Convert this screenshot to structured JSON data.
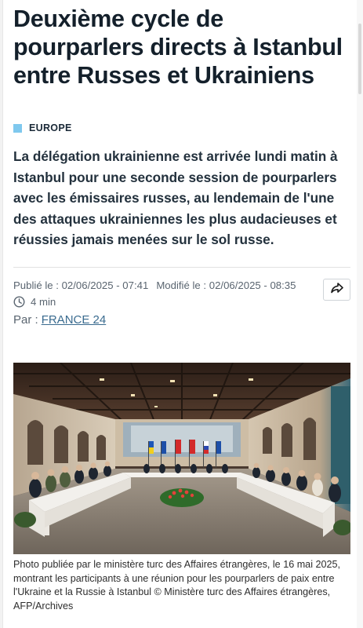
{
  "article": {
    "headline": "Deuxième cycle de pourparlers directs à Istanbul entre Russes et Ukrainiens",
    "section": "EUROPE",
    "lede": "La délégation ukrainienne est arrivée lundi matin à Istanbul pour une seconde session de pourparlers avec les émissaires russes, au lendemain de l'une des attaques ukrainiennes les plus audacieuses et réussies jamais menées sur le sol russe.",
    "published": "Publié le : 02/06/2025 - 07:41",
    "modified": "Modifié le : 02/06/2025 - 08:35",
    "read_time": "4 min",
    "byline_prefix": "Par :",
    "byline_source": "FRANCE 24",
    "caption": "Photo publiée par le ministère turc des Affaires étrangères, le 16 mai 2025, montrant les participants à une réunion pour les pourparlers de paix entre l'Ukraine et la Russie à Istanbul © Ministère turc des Affaires étrangères, AFP/Archives"
  },
  "icons": {
    "share": "share-arrow-icon",
    "clock": "clock-icon"
  },
  "colors": {
    "section_accent": "#7fc8ee",
    "headline": "#14202b",
    "link": "#3a6b8f"
  }
}
